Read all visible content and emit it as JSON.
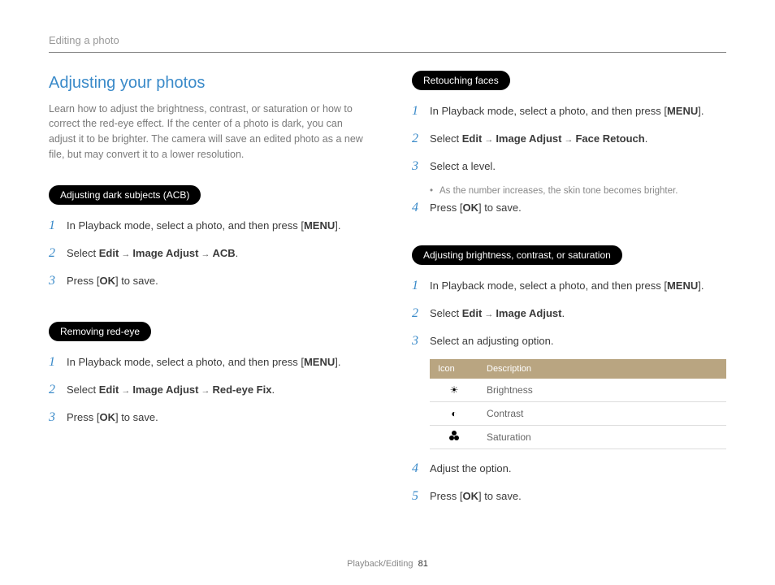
{
  "header": {
    "breadcrumb": "Editing a photo"
  },
  "title": "Adjusting your photos",
  "intro": "Learn how to adjust the brightness, contrast, or saturation or how to correct the red-eye effect. If the center of a photo is dark, you can adjust it to be brighter. The camera will save an edited photo as a new file, but may convert it to a lower resolution.",
  "labels": {
    "menu": "MENU",
    "ok": "OK",
    "arrow": "→"
  },
  "sections": {
    "acb": {
      "heading": "Adjusting dark subjects (ACB)",
      "step1_a": "In Playback mode, select a photo, and then press [",
      "step1_b": "].",
      "step2_a": "Select ",
      "step2_edit": "Edit",
      "step2_ia": "Image Adjust",
      "step2_acb": "ACB",
      "step2_b": ".",
      "step3_a": "Press [",
      "step3_b": "] to save."
    },
    "redeye": {
      "heading": "Removing red-eye",
      "step1_a": "In Playback mode, select a photo, and then press [",
      "step1_b": "].",
      "step2_a": "Select ",
      "step2_edit": "Edit",
      "step2_ia": "Image Adjust",
      "step2_fix": "Red-eye Fix",
      "step2_b": ".",
      "step3_a": "Press [",
      "step3_b": "] to save."
    },
    "retouch": {
      "heading": "Retouching faces",
      "step1_a": "In Playback mode, select a photo, and then press [",
      "step1_b": "].",
      "step2_a": "Select ",
      "step2_edit": "Edit",
      "step2_ia": "Image Adjust",
      "step2_face": "Face Retouch",
      "step2_b": ".",
      "step3": "Select a level.",
      "step3_sub": "As the number increases, the skin tone becomes brighter.",
      "step4_a": "Press [",
      "step4_b": "] to save."
    },
    "bcs": {
      "heading": "Adjusting brightness, contrast, or saturation",
      "step1_a": "In Playback mode, select a photo, and then press [",
      "step1_b": "].",
      "step2_a": "Select ",
      "step2_edit": "Edit",
      "step2_ia": "Image Adjust",
      "step2_b": ".",
      "step3": "Select an adjusting option.",
      "table": {
        "col1": "Icon",
        "col2": "Description",
        "rows": [
          {
            "icon": "brightness",
            "desc": "Brightness"
          },
          {
            "icon": "contrast",
            "desc": "Contrast"
          },
          {
            "icon": "saturation",
            "desc": "Saturation"
          }
        ]
      },
      "step4": "Adjust the option.",
      "step5_a": "Press [",
      "step5_b": "] to save."
    }
  },
  "footer": {
    "section": "Playback/Editing",
    "page": "81"
  }
}
